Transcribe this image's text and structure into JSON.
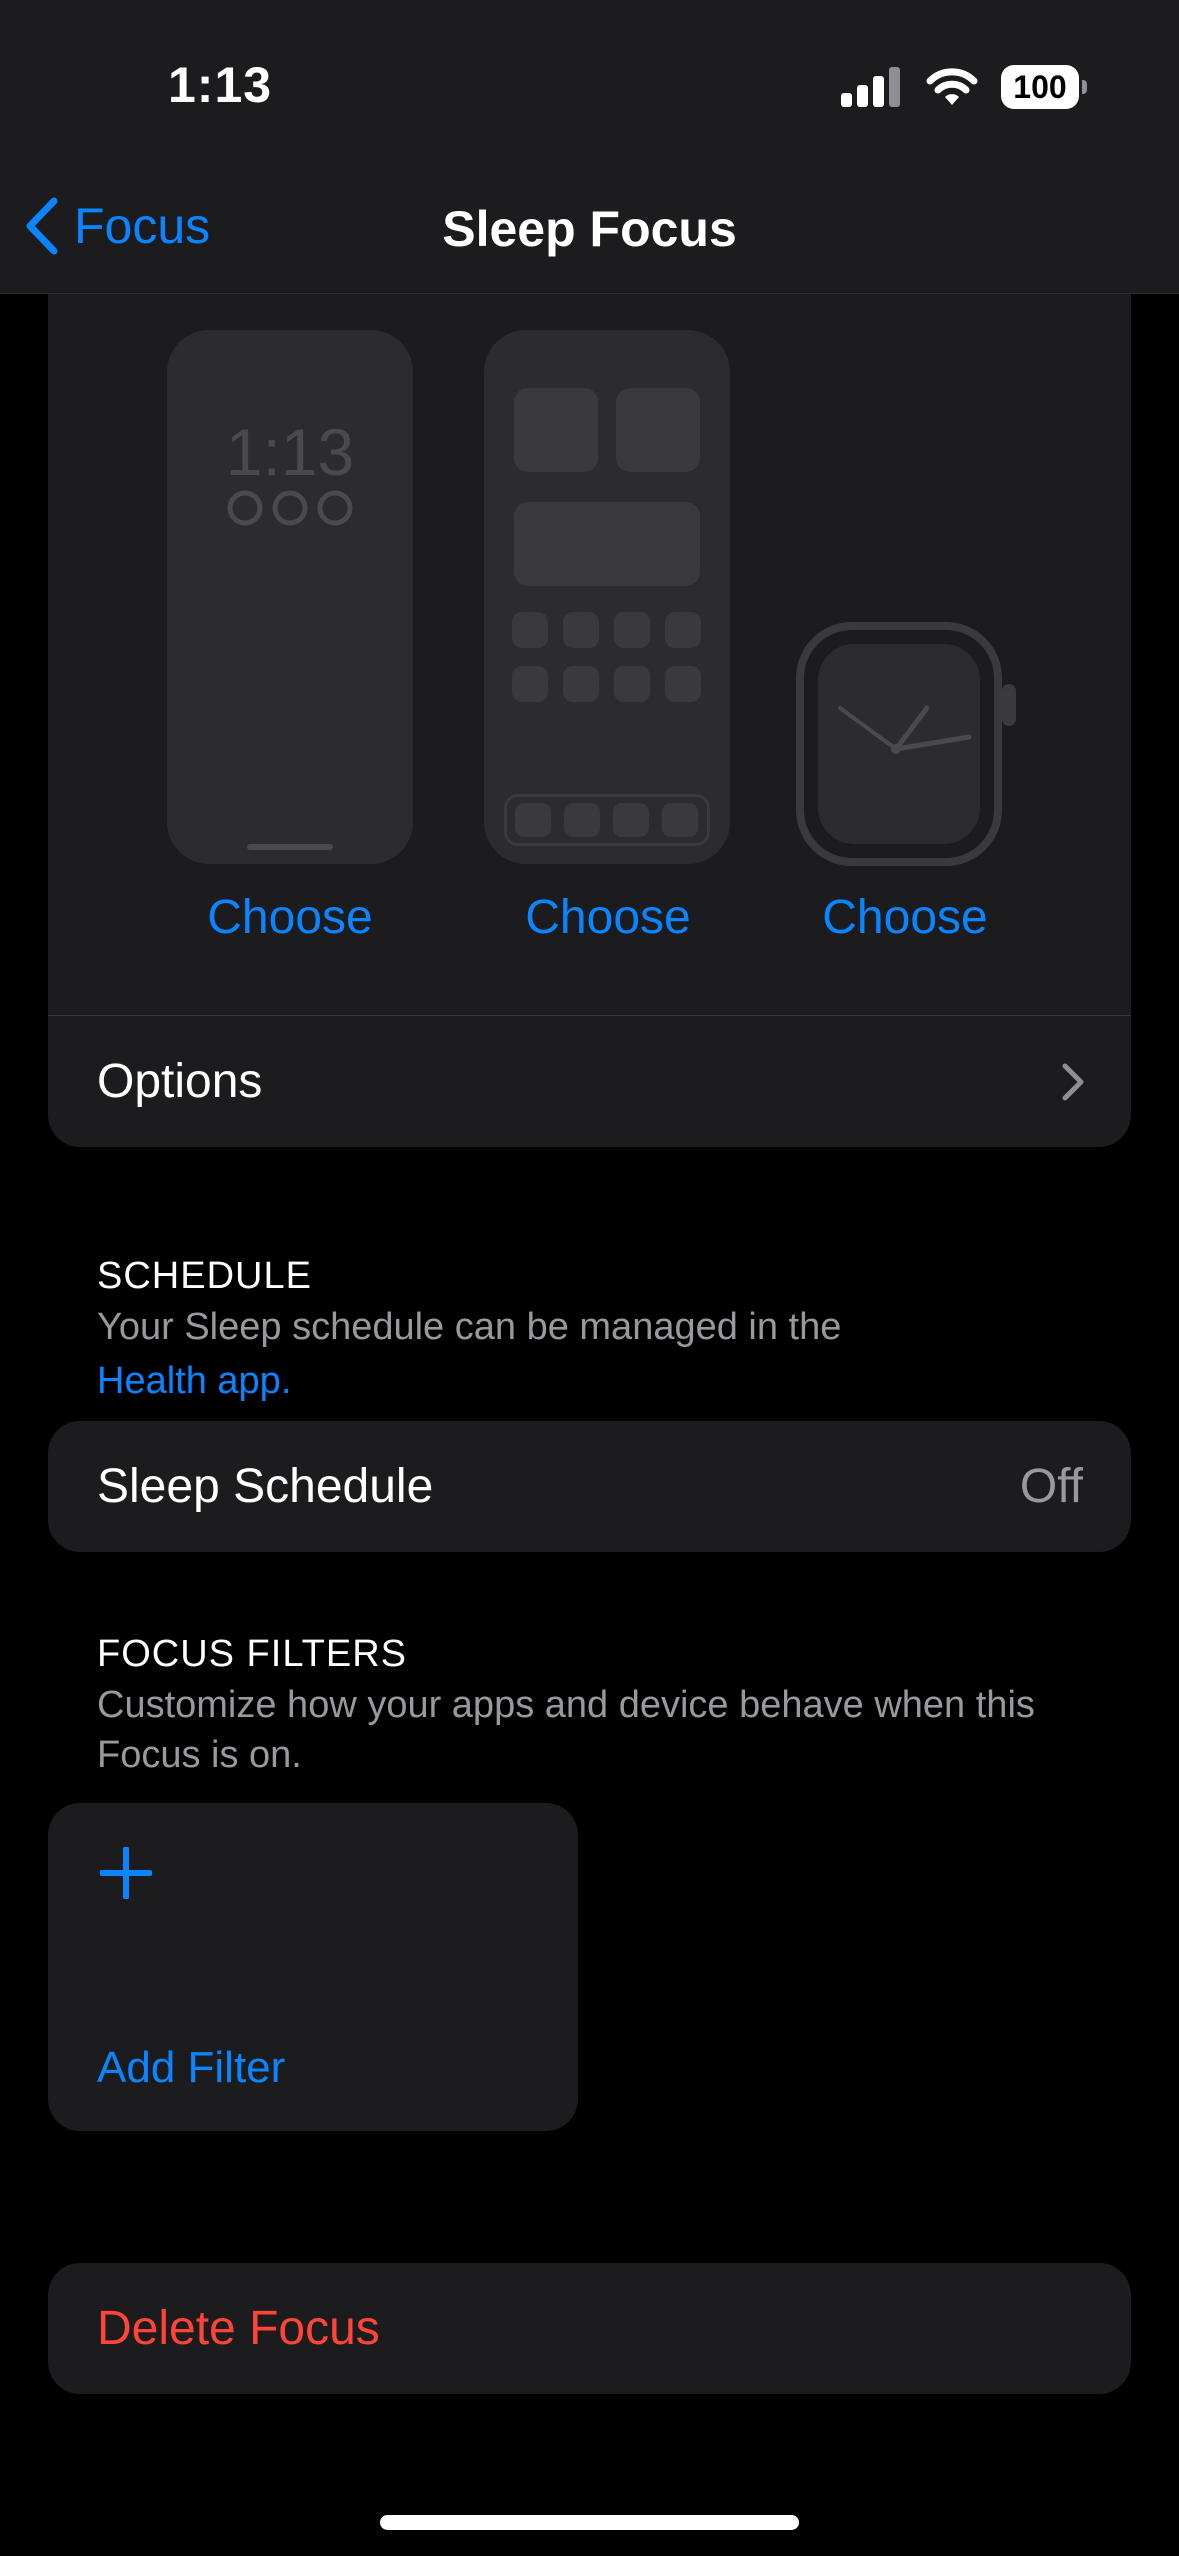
{
  "status_bar": {
    "time": "1:13",
    "battery": "100"
  },
  "nav": {
    "back_label": "Focus",
    "title": "Sleep Focus"
  },
  "customization": {
    "lock_screen_preview_time": "1:13",
    "choose_lock_screen": "Choose",
    "choose_home_screen": "Choose",
    "choose_watch_face": "Choose",
    "options_label": "Options"
  },
  "schedule": {
    "header": "SCHEDULE",
    "description_prefix": "Your Sleep schedule can be managed in the",
    "description_link": "Health app",
    "description_suffix": ".",
    "row_label": "Sleep Schedule",
    "row_value": "Off"
  },
  "filters": {
    "header": "FOCUS FILTERS",
    "description": "Customize how your apps and device behave when this Focus is on.",
    "add_label": "Add Filter"
  },
  "delete": {
    "label": "Delete Focus"
  },
  "colors": {
    "accent": "#0a84ff",
    "destructive": "#ff453a",
    "panel": "#1c1c1e",
    "background": "#000000"
  },
  "icons": [
    "cellular-signal-icon",
    "wifi-icon",
    "battery-icon",
    "chevron-left-icon",
    "chevron-right-icon",
    "plus-icon"
  ]
}
